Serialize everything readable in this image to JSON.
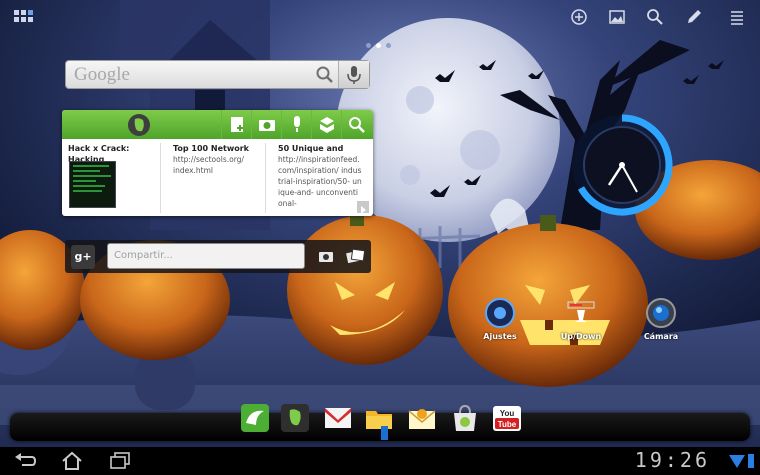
{
  "status_bar": {
    "time": "19:26"
  },
  "top_bar": {
    "icons": [
      "apps-icon",
      "add-icon",
      "wallpaper-icon",
      "search-icon",
      "edit-icon",
      "menu-icon"
    ]
  },
  "google_search": {
    "logo": "Google",
    "icons": [
      "magnifier-icon",
      "microphone-icon"
    ]
  },
  "evernote_widget": {
    "toolbar_icons": [
      "evernote-logo-icon",
      "new-note-icon",
      "camera-note-icon",
      "voice-note-icon",
      "add-image-note-icon",
      "search-icon"
    ],
    "notes": [
      {
        "title": "Hack x Crack: Hacking",
        "body": ""
      },
      {
        "title": "Top 100 Network",
        "body": "http://sectools.org/ index.html"
      },
      {
        "title": "50 Unique and",
        "body": "http://inspirationfeed. com/inspiration/ industrial-inspiration/50- unique-and- unconventional-"
      }
    ]
  },
  "gplus_widget": {
    "logo": "g+",
    "placeholder": "Compartir...",
    "icons": [
      "camera-icon",
      "photos-icon"
    ]
  },
  "shortcuts": [
    {
      "label": "Ajustes",
      "icon": "settings-icon"
    },
    {
      "label": "Up/Down",
      "icon": "updown-icon"
    },
    {
      "label": "Cámara",
      "icon": "camera-icon"
    }
  ],
  "dock": {
    "apps": [
      "dolphin-browser-icon",
      "evernote-icon",
      "gmail-icon",
      "file-manager-icon",
      "email-icon",
      "market-icon",
      "youtube-icon"
    ],
    "youtube_label": "You Tube"
  },
  "nav_bar": {
    "buttons": [
      "back-icon",
      "home-icon",
      "recent-apps-icon"
    ]
  },
  "colors": {
    "evernote_green": "#5cb530",
    "dock_bg": "#000000"
  }
}
